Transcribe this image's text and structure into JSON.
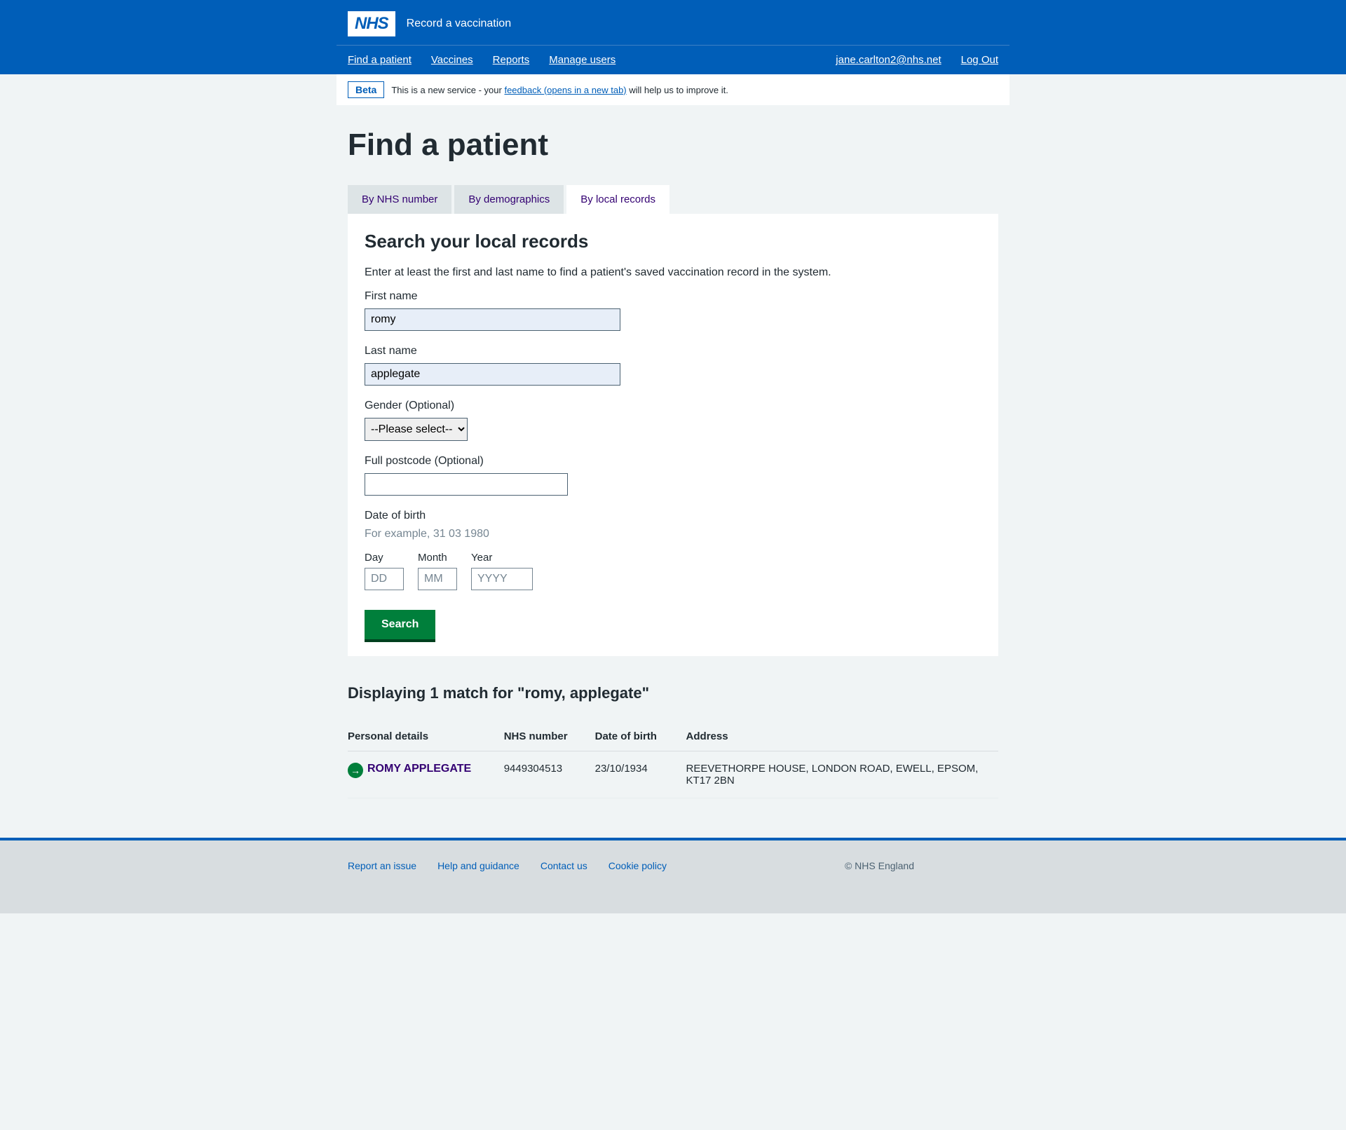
{
  "header": {
    "logo_text": "NHS",
    "service_name": "Record a vaccination"
  },
  "nav": {
    "left": [
      {
        "label": "Find a patient"
      },
      {
        "label": "Vaccines"
      },
      {
        "label": "Reports"
      },
      {
        "label": "Manage users"
      }
    ],
    "right": [
      {
        "label": "jane.carlton2@nhs.net"
      },
      {
        "label": "Log Out"
      }
    ]
  },
  "phase": {
    "tag": "Beta",
    "text_before": "This is a new service - your ",
    "link_text": "feedback (opens in a new tab)",
    "text_after": " will help us to improve it."
  },
  "page_title": "Find a patient",
  "tabs": [
    {
      "label": "By NHS number",
      "active": false
    },
    {
      "label": "By demographics",
      "active": false
    },
    {
      "label": "By local records",
      "active": true
    }
  ],
  "panel": {
    "heading": "Search your local records",
    "intro": "Enter at least the first and last name to find a patient's saved vaccination record in the system.",
    "first_name_label": "First name",
    "first_name_value": "romy",
    "last_name_label": "Last name",
    "last_name_value": "applegate",
    "gender_label": "Gender (Optional)",
    "gender_selected": "--Please select--",
    "postcode_label": "Full postcode (Optional)",
    "postcode_value": "",
    "dob_legend": "Date of birth",
    "dob_hint": "For example, 31 03 1980",
    "dob_day_label": "Day",
    "dob_day_placeholder": "DD",
    "dob_month_label": "Month",
    "dob_month_placeholder": "MM",
    "dob_year_label": "Year",
    "dob_year_placeholder": "YYYY",
    "search_button": "Search"
  },
  "results": {
    "heading": "Displaying 1 match for \"romy, applegate\"",
    "columns": [
      "Personal details",
      "NHS number",
      "Date of birth",
      "Address"
    ],
    "rows": [
      {
        "name": "ROMY APPLEGATE",
        "nhs_number": "9449304513",
        "dob": "23/10/1934",
        "address": "REEVETHORPE HOUSE, LONDON ROAD, EWELL, EPSOM, KT17 2BN"
      }
    ]
  },
  "footer": {
    "links": [
      {
        "label": "Report an issue"
      },
      {
        "label": "Help and guidance"
      },
      {
        "label": "Contact us"
      },
      {
        "label": "Cookie policy"
      }
    ],
    "copyright": "© NHS England"
  }
}
